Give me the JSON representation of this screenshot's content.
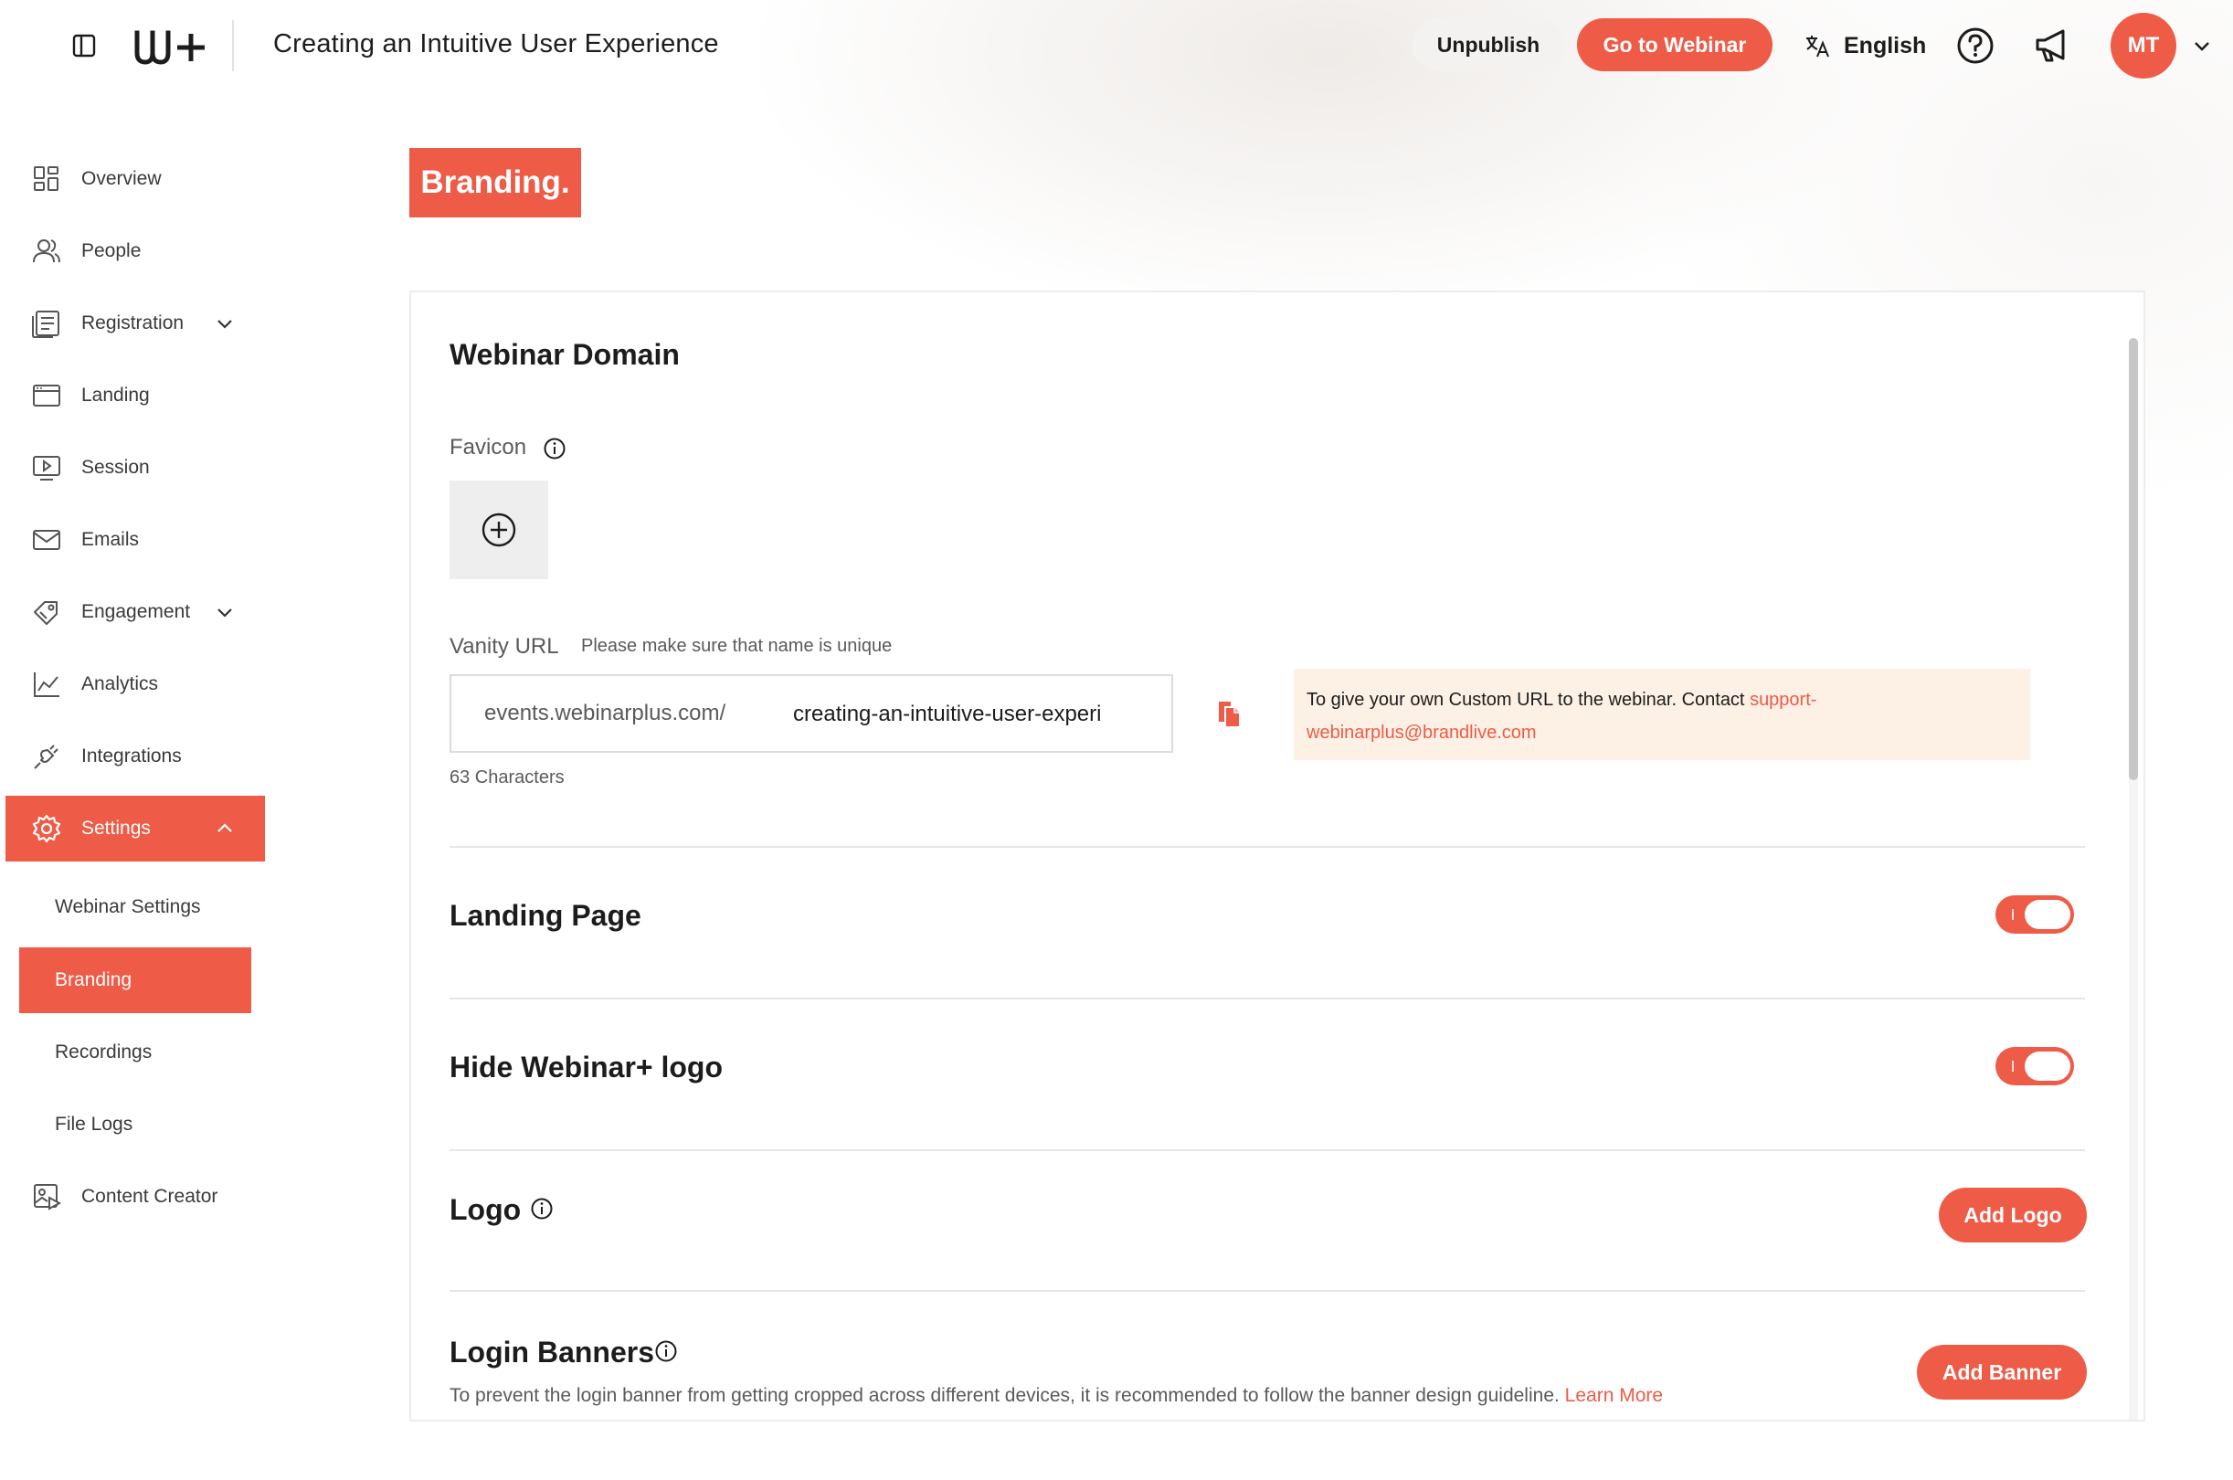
{
  "header": {
    "title": "Creating an Intuitive User Experience",
    "unpublish_label": "Unpublish",
    "goto_label": "Go to Webinar",
    "language": "English",
    "avatar_initials": "MT",
    "logo_text": "W+"
  },
  "colors": {
    "accent": "#ee5b47",
    "notice_bg": "#fdf1e6"
  },
  "sidebar": {
    "items": [
      {
        "label": "Overview",
        "icon": "grid-icon"
      },
      {
        "label": "People",
        "icon": "people-icon"
      },
      {
        "label": "Registration",
        "icon": "form-icon"
      },
      {
        "label": "Landing",
        "icon": "browser-icon"
      },
      {
        "label": "Session",
        "icon": "video-icon"
      },
      {
        "label": "Emails",
        "icon": "mail-icon"
      },
      {
        "label": "Engagement",
        "icon": "engagement-icon"
      },
      {
        "label": "Analytics",
        "icon": "analytics-icon"
      },
      {
        "label": "Integrations",
        "icon": "plug-icon"
      },
      {
        "label": "Settings",
        "icon": "gear-icon"
      },
      {
        "label": "Content Creator",
        "icon": "content-creator-icon"
      }
    ],
    "settings_sub": [
      {
        "label": "Webinar Settings"
      },
      {
        "label": "Branding"
      },
      {
        "label": "Recordings"
      },
      {
        "label": "File Logs"
      }
    ],
    "active_item": "Settings",
    "active_sub": "Branding"
  },
  "page": {
    "title": "Branding."
  },
  "webinar_domain": {
    "title": "Webinar Domain",
    "favicon_label": "Favicon",
    "vanity_label": "Vanity URL",
    "vanity_hint": "Please make sure that name is unique",
    "url_prefix": "events.webinarplus.com/",
    "url_value": "creating-an-intuitive-user-experi",
    "char_count": "63 Characters",
    "notice_text": "To give your own Custom URL to the webinar. Contact ",
    "notice_link_1": "support-",
    "notice_link_2": "webinarplus@brandlive.com"
  },
  "landing_page": {
    "title": "Landing Page",
    "enabled": true
  },
  "hide_logo": {
    "title": "Hide Webinar+ logo",
    "enabled": true
  },
  "logo": {
    "title": "Logo",
    "button_label": "Add Logo"
  },
  "login_banners": {
    "title": "Login Banners",
    "button_label": "Add Banner",
    "description": "To prevent the login banner from getting cropped across different devices, it is recommended to follow the banner design guideline. ",
    "learn_more": "Learn More"
  }
}
